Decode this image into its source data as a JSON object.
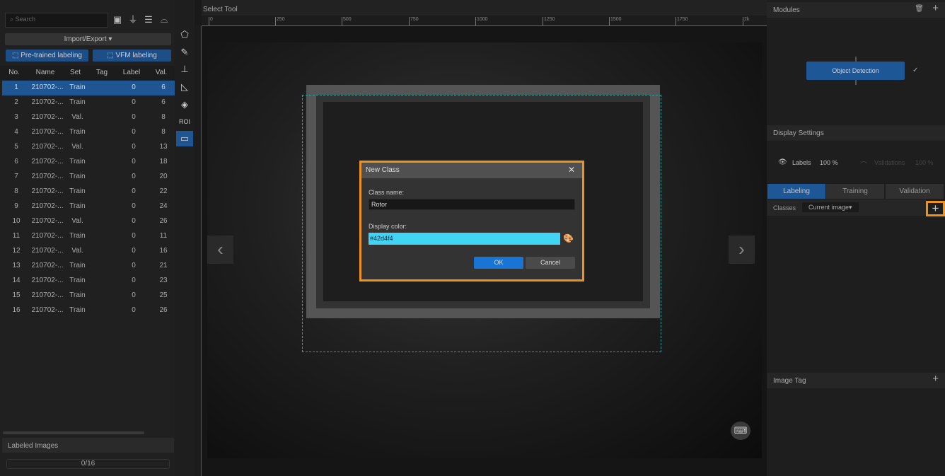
{
  "left_panel": {
    "search_placeholder": "Search",
    "toolbar_icons": [
      "image-filter-icon",
      "funnel-icon",
      "list-icon",
      "layout-icon"
    ],
    "import_export": "Import/Export ▾",
    "pretrained": "Pre-trained labeling",
    "vfm": "VFM labeling",
    "columns": [
      "No.",
      "Name",
      "Set",
      "Tag",
      "Label",
      "Val."
    ],
    "rows": [
      [
        "1",
        "210702-...",
        "Train",
        "",
        "0",
        "6"
      ],
      [
        "2",
        "210702-...",
        "Train",
        "",
        "0",
        "6"
      ],
      [
        "3",
        "210702-...",
        "Val.",
        "",
        "0",
        "8"
      ],
      [
        "4",
        "210702-...",
        "Train",
        "",
        "0",
        "8"
      ],
      [
        "5",
        "210702-...",
        "Val.",
        "",
        "0",
        "13"
      ],
      [
        "6",
        "210702-...",
        "Train",
        "",
        "0",
        "18"
      ],
      [
        "7",
        "210702-...",
        "Train",
        "",
        "0",
        "20"
      ],
      [
        "8",
        "210702-...",
        "Train",
        "",
        "0",
        "22"
      ],
      [
        "9",
        "210702-...",
        "Train",
        "",
        "0",
        "24"
      ],
      [
        "10",
        "210702-...",
        "Val.",
        "",
        "0",
        "26"
      ],
      [
        "11",
        "210702-...",
        "Train",
        "",
        "0",
        "11"
      ],
      [
        "12",
        "210702-...",
        "Val.",
        "",
        "0",
        "16"
      ],
      [
        "13",
        "210702-...",
        "Train",
        "",
        "0",
        "21"
      ],
      [
        "14",
        "210702-...",
        "Train",
        "",
        "0",
        "23"
      ],
      [
        "15",
        "210702-...",
        "Train",
        "",
        "0",
        "25"
      ],
      [
        "16",
        "210702-...",
        "Train",
        "",
        "0",
        "26"
      ]
    ],
    "selected_row": 0,
    "labeled_images_title": "Labeled Images",
    "labeled_progress": "0/16"
  },
  "tools": {
    "roi_label": "ROI"
  },
  "canvas": {
    "tool_title": "Select Tool",
    "ruler_ticks": [
      "0",
      "250",
      "500",
      "750",
      "1000",
      "1250",
      "1500",
      "1750",
      "2k"
    ]
  },
  "dialog": {
    "title": "New Class",
    "class_name_label": "Class name:",
    "class_name_value": "Rotor",
    "display_color_label": "Display color:",
    "display_color_value": "#42d4f4",
    "ok": "OK",
    "cancel": "Cancel"
  },
  "right_panel": {
    "modules_title": "Modules",
    "module": "Object Detection",
    "display_settings_title": "Display Settings",
    "labels": "Labels",
    "labels_pct": "100 %",
    "validations": "Validations",
    "validations_pct": "100 %",
    "tabs": [
      "Labeling",
      "Training",
      "Validation"
    ],
    "classes_label": "Classes",
    "classes_filter": "Current image▾",
    "image_tag_title": "Image Tag"
  },
  "colors": {
    "accent": "#1e5796",
    "highlight": "#f0921e",
    "class_color": "#42d4f4"
  }
}
